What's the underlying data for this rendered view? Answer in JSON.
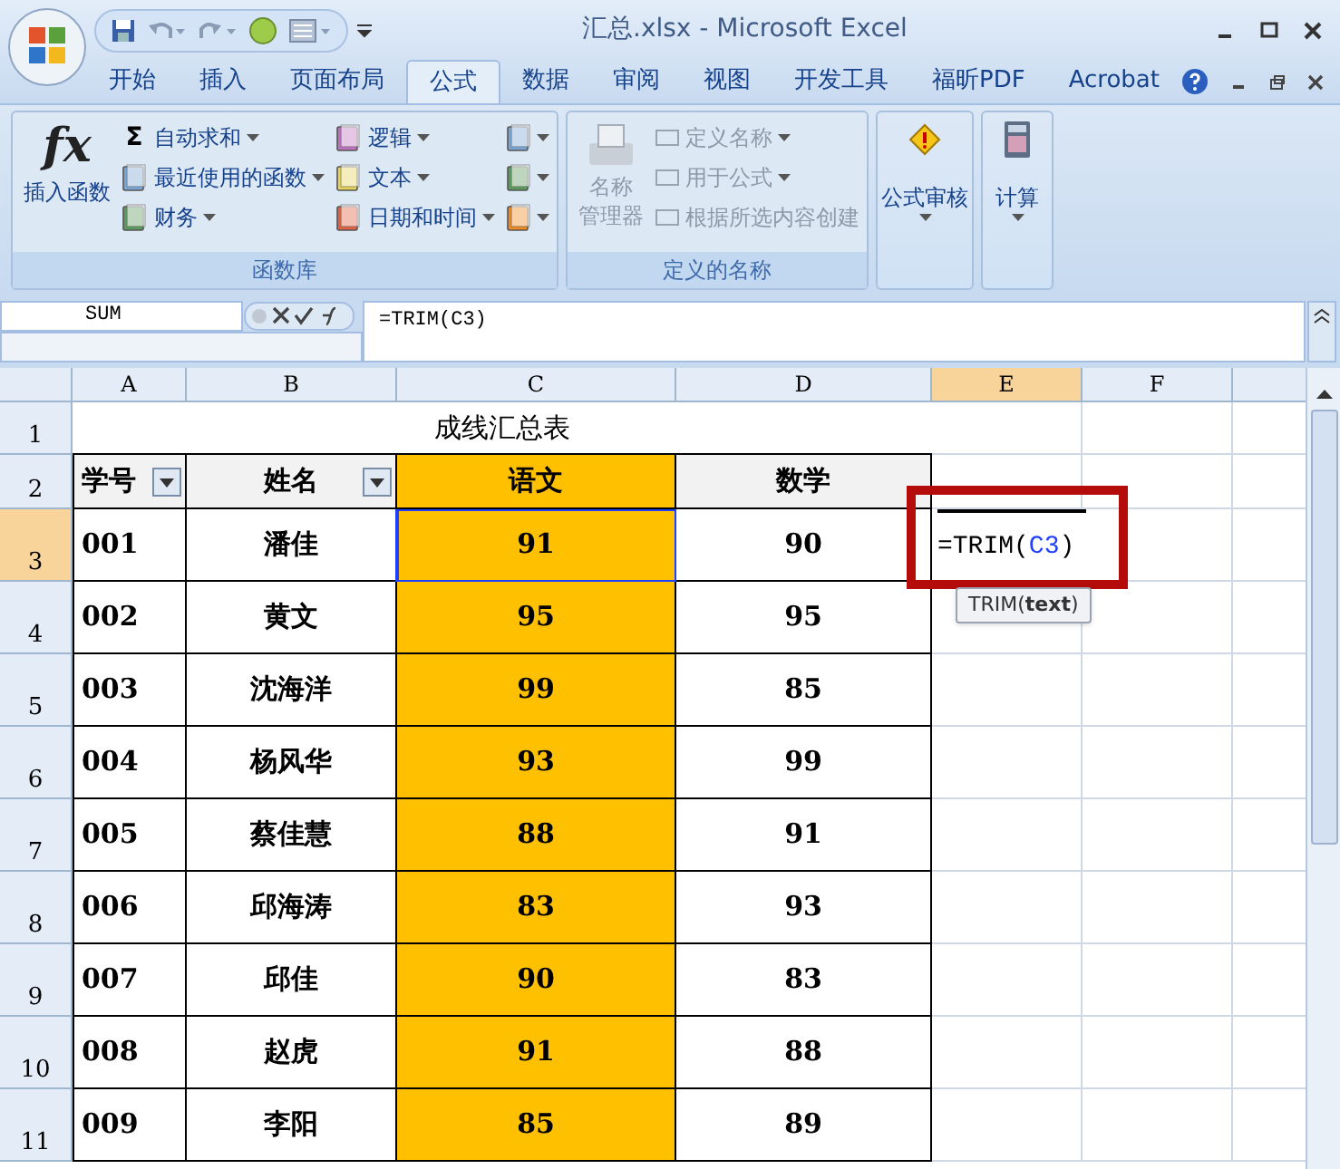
{
  "window": {
    "title": "汇总.xlsx - Microsoft Excel"
  },
  "tabs": [
    {
      "label": "开始",
      "selected": false
    },
    {
      "label": "插入",
      "selected": false
    },
    {
      "label": "页面布局",
      "selected": false
    },
    {
      "label": "公式",
      "selected": true
    },
    {
      "label": "数据",
      "selected": false
    },
    {
      "label": "审阅",
      "selected": false
    },
    {
      "label": "视图",
      "selected": false
    },
    {
      "label": "开发工具",
      "selected": false
    },
    {
      "label": "福昕PDF",
      "selected": false
    },
    {
      "label": "Acrobat",
      "selected": false
    }
  ],
  "ribbon": {
    "function_library": {
      "title": "函数库",
      "insert_function": {
        "icon_text": "fx",
        "label": "插入函数"
      },
      "column_1": [
        {
          "glyph": "Σ",
          "label": "自动求和",
          "kind": "sigma"
        },
        {
          "label": "最近使用的函数",
          "kind": "star"
        },
        {
          "label": "财务",
          "kind": "money"
        }
      ],
      "column_2": [
        {
          "label": "逻辑",
          "kind": "logic"
        },
        {
          "label": "文本",
          "kind": "text"
        },
        {
          "label": "日期和时间",
          "kind": "date"
        }
      ]
    },
    "defined_names": {
      "title": "定义的名称",
      "name_manager": {
        "label_lines": [
          "名称",
          "管理器"
        ],
        "disabled": true
      },
      "items": [
        {
          "label": "定义名称",
          "dropdown": true,
          "disabled": true
        },
        {
          "label": "用于公式",
          "dropdown": true,
          "disabled": true
        },
        {
          "label": "根据所选内容创建",
          "dropdown": false,
          "disabled": true
        }
      ]
    },
    "large_buttons": [
      {
        "label": "公式审核",
        "kind": "audit"
      },
      {
        "label": "计算",
        "kind": "calc"
      }
    ]
  },
  "formula_bar": {
    "name_box": "SUM",
    "formula": "=TRIM(C3)"
  },
  "sheet": {
    "columns": [
      {
        "label": "A",
        "selected": false
      },
      {
        "label": "B",
        "selected": false
      },
      {
        "label": "C",
        "selected": false
      },
      {
        "label": "D",
        "selected": false
      },
      {
        "label": "E",
        "selected": true
      },
      {
        "label": "F",
        "selected": false
      }
    ],
    "row_numbers": [
      {
        "label": "1",
        "selected": false
      },
      {
        "label": "2",
        "selected": false
      },
      {
        "label": "3",
        "selected": true
      },
      {
        "label": "4",
        "selected": false
      },
      {
        "label": "5",
        "selected": false
      },
      {
        "label": "6",
        "selected": false
      },
      {
        "label": "7",
        "selected": false
      },
      {
        "label": "8",
        "selected": false
      },
      {
        "label": "9",
        "selected": false
      },
      {
        "label": "10",
        "selected": false
      },
      {
        "label": "11",
        "selected": false
      }
    ],
    "title": "成线汇总表",
    "headers": [
      {
        "text": "学号",
        "filter": true,
        "highlight": false
      },
      {
        "text": "姓名",
        "filter": true,
        "highlight": false
      },
      {
        "text": "语文",
        "filter": false,
        "highlight": true
      },
      {
        "text": "数学",
        "filter": false,
        "highlight": false
      }
    ],
    "rows": [
      [
        {
          "text": "001",
          "selected": false
        },
        {
          "text": "潘佳",
          "selected": false
        },
        {
          "text": "91",
          "selected": true
        },
        {
          "text": "90",
          "selected": false
        }
      ],
      [
        {
          "text": "002",
          "selected": false
        },
        {
          "text": "黄文",
          "selected": false
        },
        {
          "text": "95",
          "selected": false
        },
        {
          "text": "95",
          "selected": false
        }
      ],
      [
        {
          "text": "003",
          "selected": false
        },
        {
          "text": "沈海洋",
          "selected": false
        },
        {
          "text": "99",
          "selected": false
        },
        {
          "text": "85",
          "selected": false
        }
      ],
      [
        {
          "text": "004",
          "selected": false
        },
        {
          "text": "杨风华",
          "selected": false
        },
        {
          "text": "93",
          "selected": false
        },
        {
          "text": "99",
          "selected": false
        }
      ],
      [
        {
          "text": "005",
          "selected": false
        },
        {
          "text": "蔡佳慧",
          "selected": false
        },
        {
          "text": "88",
          "selected": false
        },
        {
          "text": "91",
          "selected": false
        }
      ],
      [
        {
          "text": "006",
          "selected": false
        },
        {
          "text": "邱海涛",
          "selected": false
        },
        {
          "text": "83",
          "selected": false
        },
        {
          "text": "93",
          "selected": false
        }
      ],
      [
        {
          "text": "007",
          "selected": false
        },
        {
          "text": "邱佳",
          "selected": false
        },
        {
          "text": "90",
          "selected": false
        },
        {
          "text": "83",
          "selected": false
        }
      ],
      [
        {
          "text": "008",
          "selected": false
        },
        {
          "text": "赵虎",
          "selected": false
        },
        {
          "text": "91",
          "selected": false
        },
        {
          "text": "88",
          "selected": false
        }
      ],
      [
        {
          "text": "009",
          "selected": false
        },
        {
          "text": "李阳",
          "selected": false
        },
        {
          "text": "85",
          "selected": false
        },
        {
          "text": "89",
          "selected": false
        }
      ]
    ],
    "editor": {
      "parts": [
        {
          "text": "=TRIM(",
          "kind": "plain"
        },
        {
          "text": "C3",
          "kind": "ref"
        },
        {
          "text": ")",
          "kind": "plain"
        }
      ],
      "tooltip": "TRIM(**text**)"
    }
  }
}
